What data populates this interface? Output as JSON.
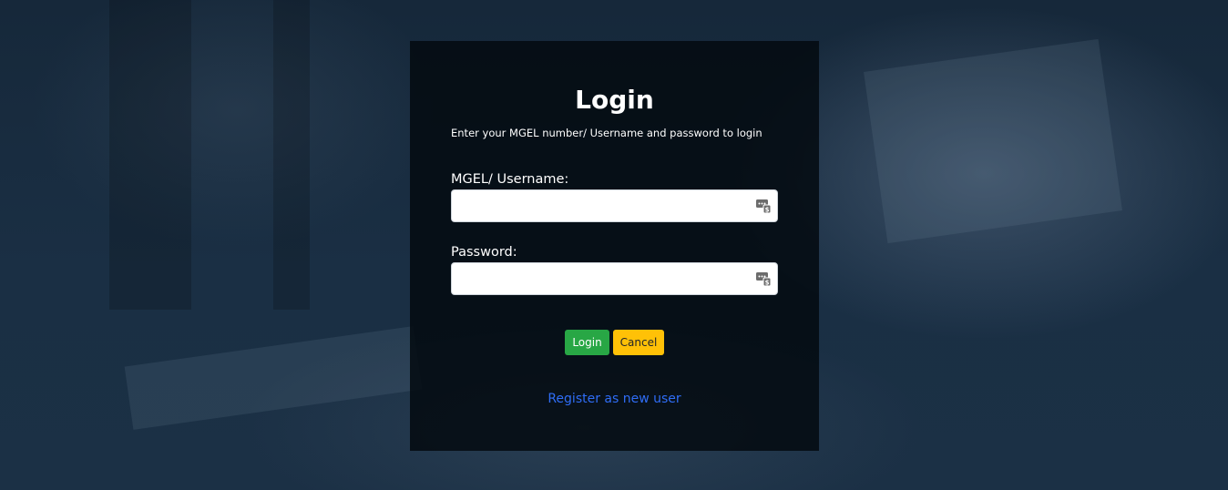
{
  "login_form": {
    "title": "Login",
    "subtitle": "Enter your MGEL number/ Username and password to login",
    "username_label": "MGEL/ Username:",
    "username_value": "",
    "password_label": "Password:",
    "password_value": "",
    "login_button": "Login",
    "cancel_button": "Cancel",
    "register_link": "Register as new user"
  },
  "colors": {
    "login_button": "#28a745",
    "cancel_button": "#ffc107",
    "register_link": "#2f6df6",
    "card_background": "#05090e"
  },
  "icons": {
    "username_field_icon": "password-manager-key-icon",
    "password_field_icon": "password-manager-key-icon"
  }
}
